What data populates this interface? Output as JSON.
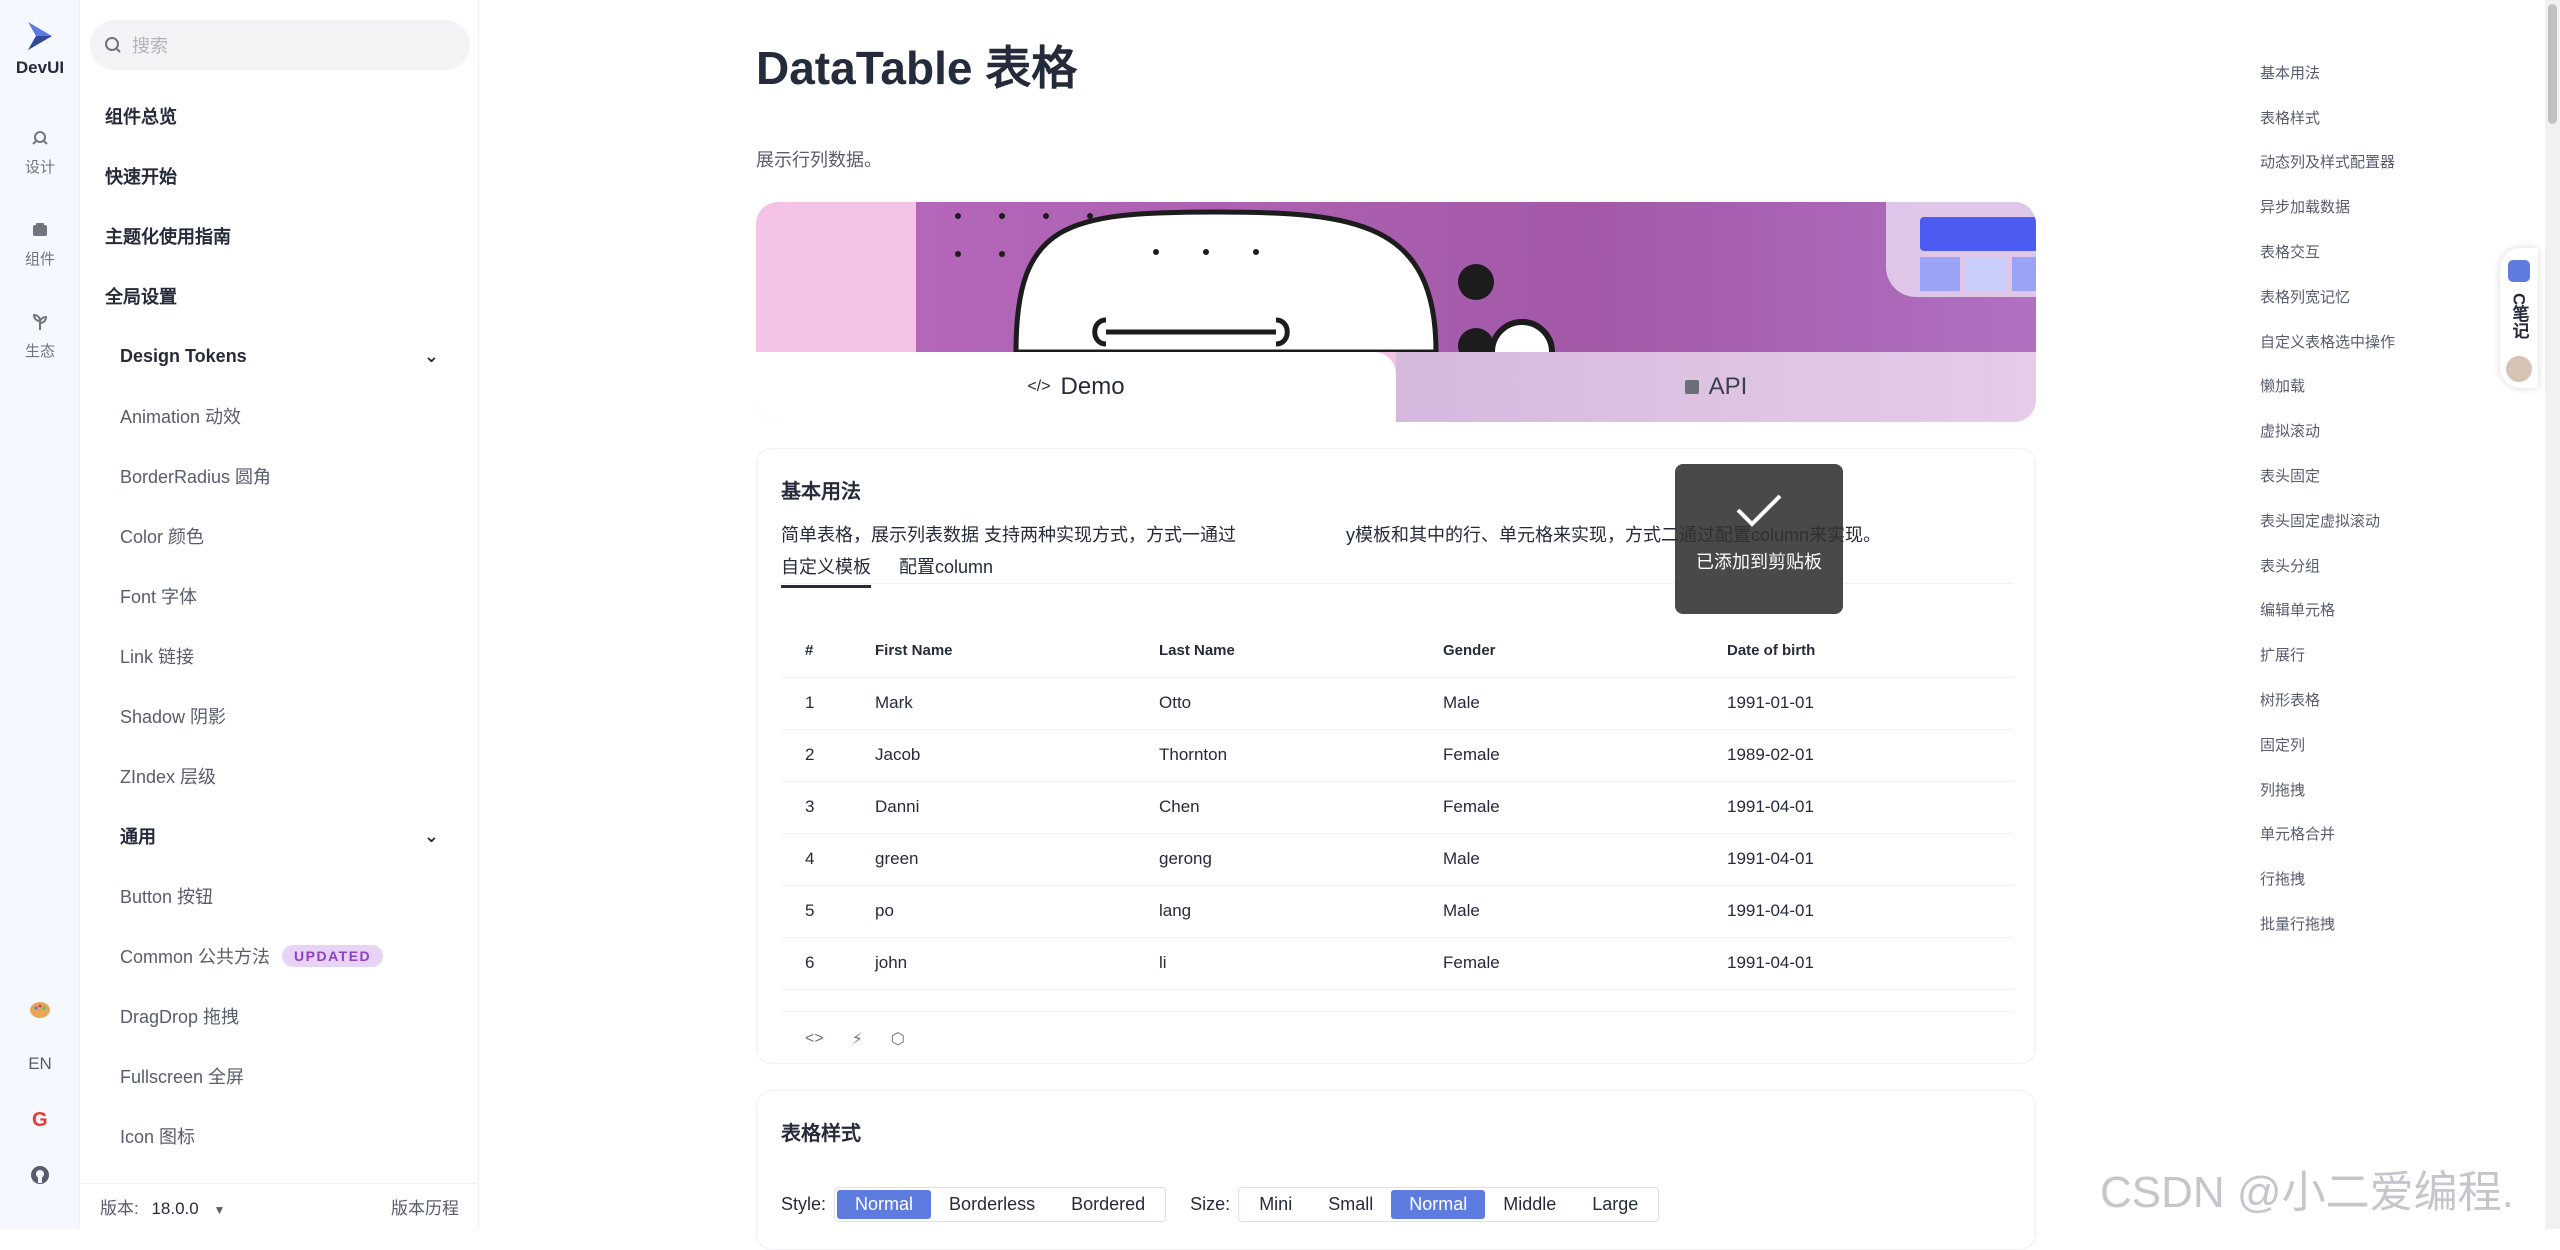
{
  "brand": {
    "name": "DevUI",
    "accent": "#5e7ce0"
  },
  "rail": {
    "items": [
      {
        "label": "设计",
        "icon": "design-icon"
      },
      {
        "label": "组件",
        "icon": "component-icon"
      },
      {
        "label": "生态",
        "icon": "ecosystem-icon"
      }
    ],
    "lang": "EN"
  },
  "search": {
    "placeholder": "搜索"
  },
  "nav": {
    "items": [
      {
        "label": "组件总览",
        "kind": "top"
      },
      {
        "label": "快速开始",
        "kind": "top"
      },
      {
        "label": "主题化使用指南",
        "kind": "top"
      },
      {
        "label": "全局设置",
        "kind": "top"
      },
      {
        "label": "Design Tokens",
        "kind": "group"
      },
      {
        "label": "Animation 动效",
        "kind": "sub"
      },
      {
        "label": "BorderRadius 圆角",
        "kind": "sub"
      },
      {
        "label": "Color 颜色",
        "kind": "sub"
      },
      {
        "label": "Font 字体",
        "kind": "sub"
      },
      {
        "label": "Link 链接",
        "kind": "sub"
      },
      {
        "label": "Shadow 阴影",
        "kind": "sub"
      },
      {
        "label": "ZIndex 层级",
        "kind": "sub"
      },
      {
        "label": "通用",
        "kind": "group"
      },
      {
        "label": "Button 按钮",
        "kind": "sub"
      },
      {
        "label": "Common 公共方法",
        "kind": "sub",
        "badge": "UPDATED"
      },
      {
        "label": "DragDrop 拖拽",
        "kind": "sub"
      },
      {
        "label": "Fullscreen 全屏",
        "kind": "sub"
      },
      {
        "label": "Icon 图标",
        "kind": "sub"
      }
    ],
    "version_label": "版本:",
    "version_value": "18.0.0",
    "history": "版本历程"
  },
  "page": {
    "title": "DataTable 表格",
    "desc": "展示行列数据。",
    "tabs": {
      "demo": "Demo",
      "api": "API"
    }
  },
  "basic": {
    "title": "基本用法",
    "desc": "简单表格，展示列表数据 支持两种实现方式，方式一通过",
    "desc_tail": "y模板和其中的行、单元格来实现，方式二通过配置column来实现。",
    "tabs": [
      "自定义模板",
      "配置column"
    ],
    "columns": [
      "#",
      "First Name",
      "Last Name",
      "Gender",
      "Date of birth"
    ],
    "rows": [
      [
        "1",
        "Mark",
        "Otto",
        "Male",
        "1991-01-01"
      ],
      [
        "2",
        "Jacob",
        "Thornton",
        "Female",
        "1989-02-01"
      ],
      [
        "3",
        "Danni",
        "Chen",
        "Female",
        "1991-04-01"
      ],
      [
        "4",
        "green",
        "gerong",
        "Male",
        "1991-04-01"
      ],
      [
        "5",
        "po",
        "lang",
        "Male",
        "1991-04-01"
      ],
      [
        "6",
        "john",
        "li",
        "Female",
        "1991-04-01"
      ]
    ]
  },
  "toast": {
    "message": "已添加到剪贴板"
  },
  "style_section": {
    "title": "表格样式",
    "style_label": "Style:",
    "style_options": [
      "Normal",
      "Borderless",
      "Bordered"
    ],
    "style_selected": "Normal",
    "size_label": "Size:",
    "size_options": [
      "Mini",
      "Small",
      "Normal",
      "Middle",
      "Large"
    ],
    "size_selected": "Normal"
  },
  "anchors": [
    "基本用法",
    "表格样式",
    "动态列及样式配置器",
    "异步加载数据",
    "表格交互",
    "表格列宽记忆",
    "自定义表格选中操作",
    "懒加载",
    "虚拟滚动",
    "表头固定",
    "表头固定虚拟滚动",
    "表头分组",
    "编辑单元格",
    "扩展行",
    "树形表格",
    "固定列",
    "列拖拽",
    "单元格合并",
    "行拖拽",
    "批量行拖拽"
  ],
  "float_widget": {
    "text": "C笔记"
  },
  "watermark": "CSDN @小二爱编程."
}
